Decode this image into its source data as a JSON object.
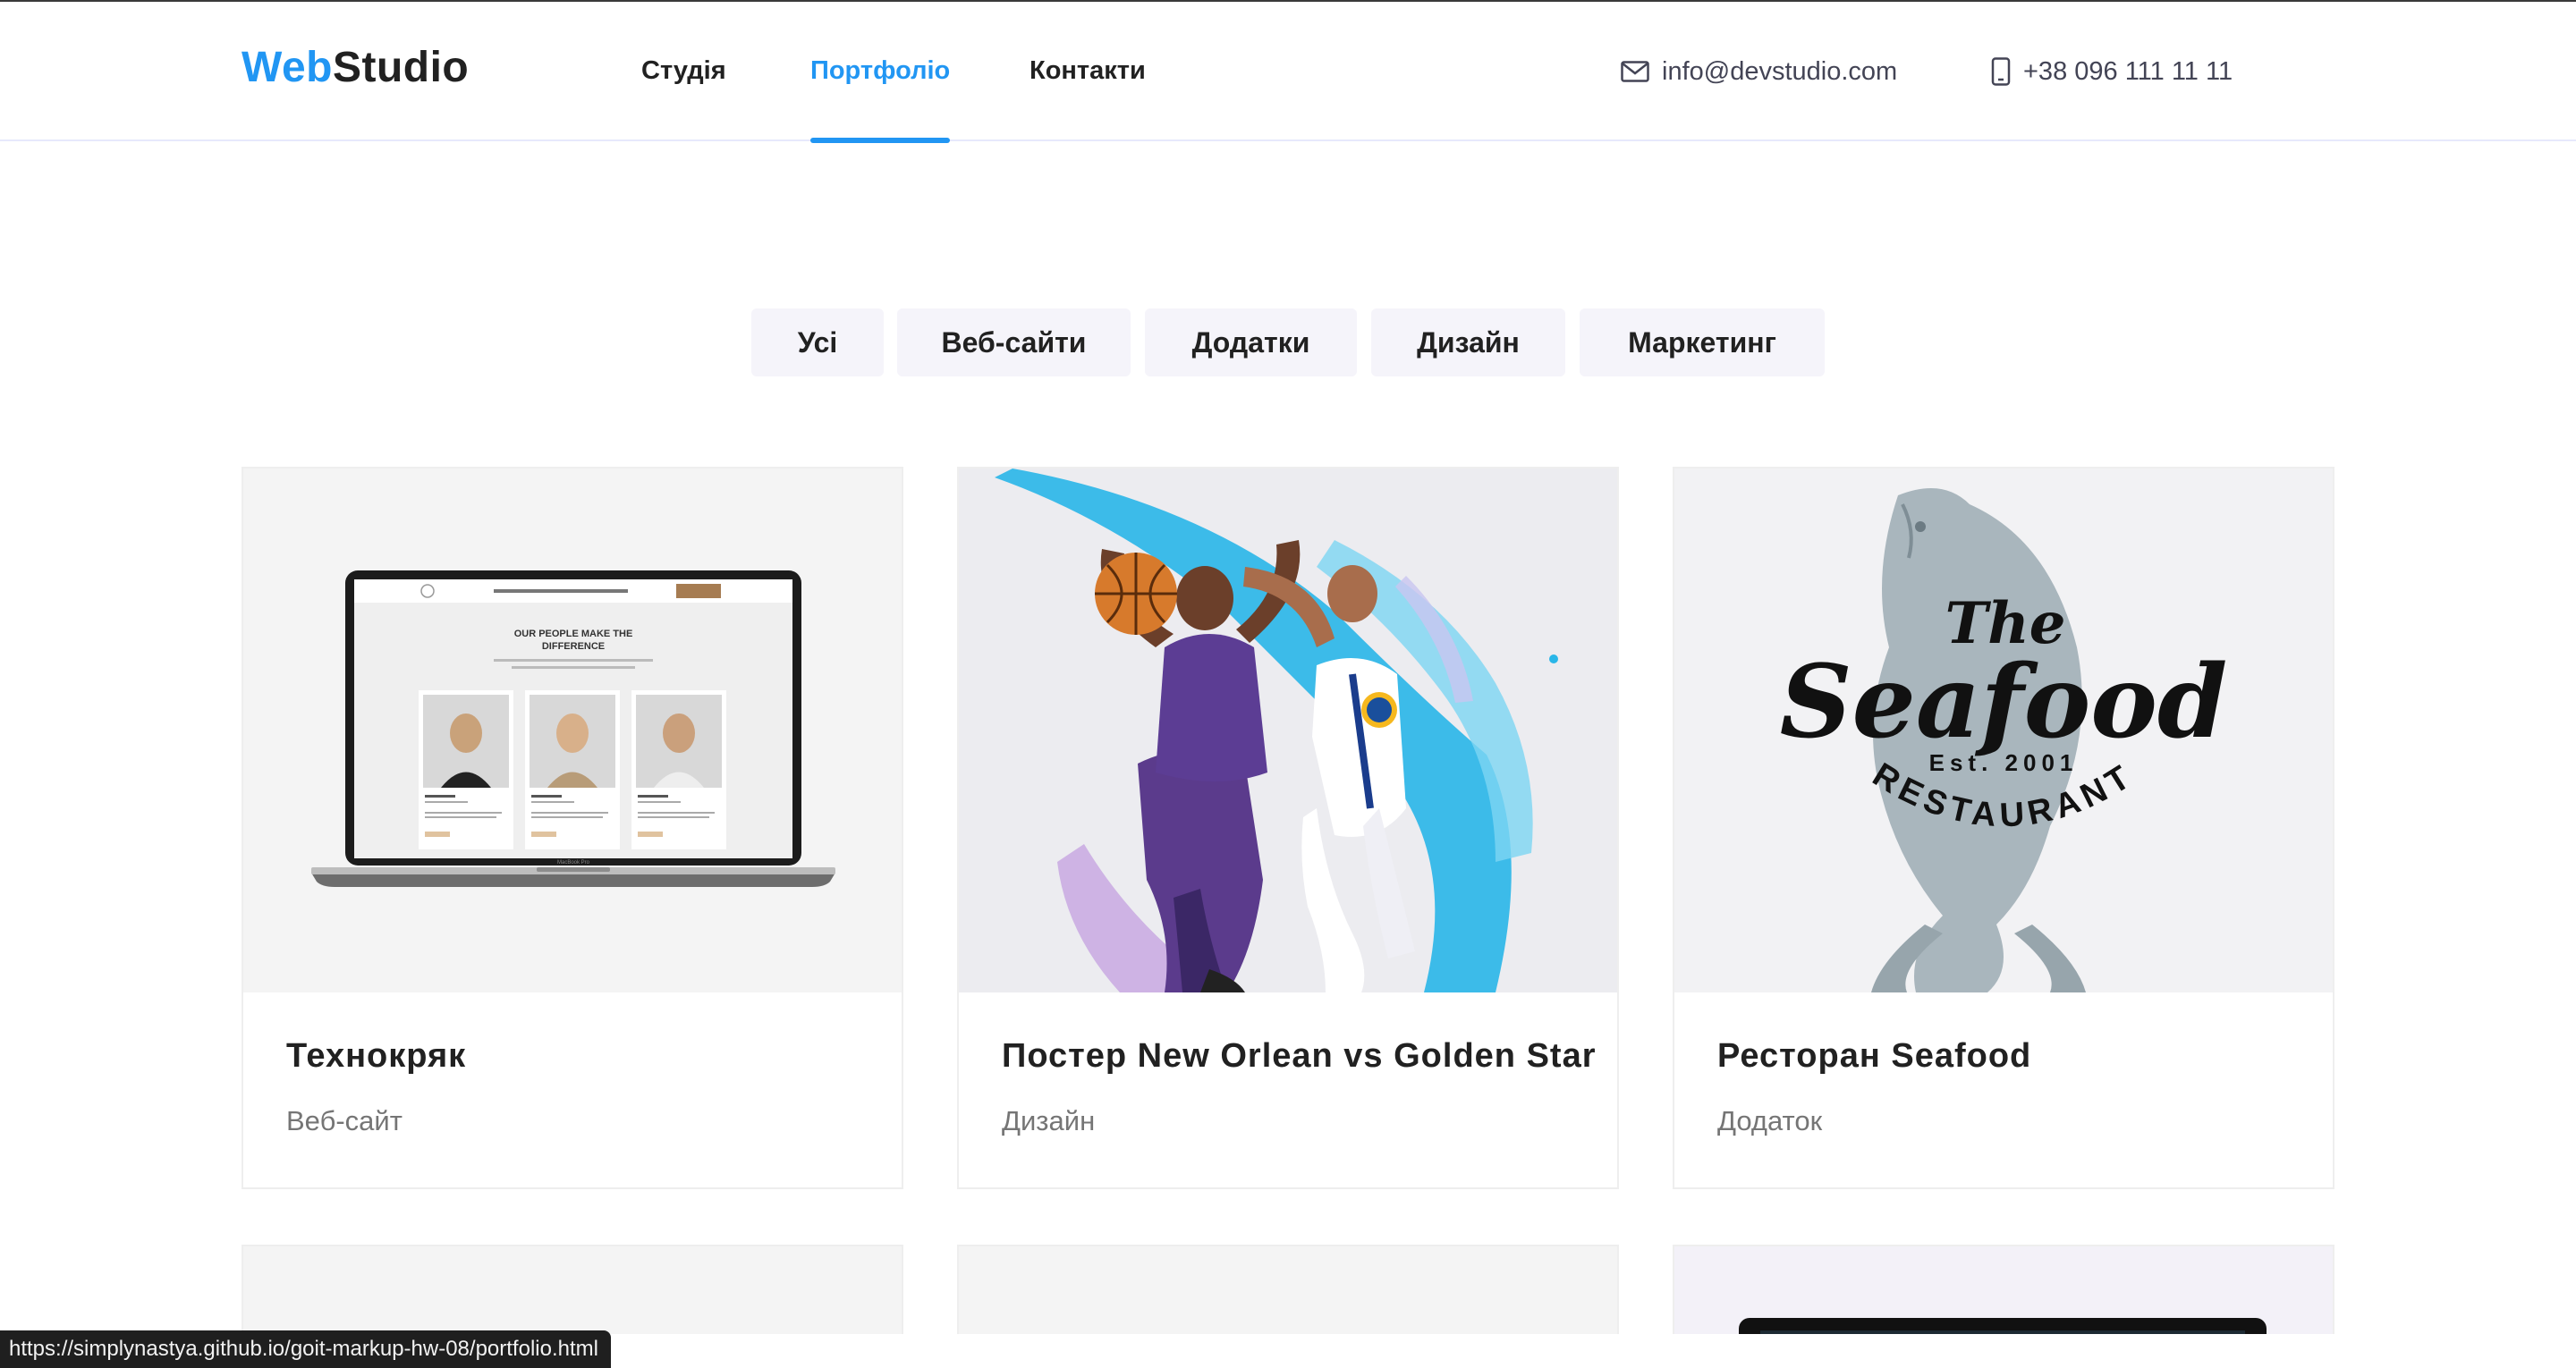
{
  "header": {
    "logo_part1": "Web",
    "logo_part2": "Studio",
    "nav": [
      {
        "label": "Студія",
        "active": false
      },
      {
        "label": "Портфоліо",
        "active": true
      },
      {
        "label": "Контакти",
        "active": false
      }
    ],
    "email": "info@devstudio.com",
    "phone": "+38 096 111 11 11",
    "email_icon": "mail-icon",
    "phone_icon": "phone-icon"
  },
  "filters": [
    "Усі",
    "Веб-сайти",
    "Додатки",
    "Дизайн",
    "Маркетинг"
  ],
  "portfolio": [
    {
      "title": "Технокряк",
      "tag": "Веб-сайт",
      "thumb": "laptop-mockup",
      "mockup": {
        "heading_line1": "OUR PEOPLE MAKE THE",
        "heading_line2": "DIFFERENCE",
        "base_label": "MacBook Pro"
      }
    },
    {
      "title": "Постер New Orlean vs Golden Star",
      "tag": "Дизайн",
      "thumb": "basketball-poster"
    },
    {
      "title": "Ресторан Seafood",
      "tag": "Додаток",
      "thumb": "seafood-logo",
      "logo_text": {
        "the": "The",
        "seafood": "Seafood",
        "est": "Est. 2001",
        "restaurant": "RESTAURANT"
      }
    }
  ],
  "status_url": "https://simplynastya.github.io/goit-markup-hw-08/portfolio.html",
  "colors": {
    "accent": "#2196f3",
    "text": "#212121",
    "muted": "#757575",
    "filter_bg": "#f5f4fa",
    "card_border": "#eeeeee"
  }
}
